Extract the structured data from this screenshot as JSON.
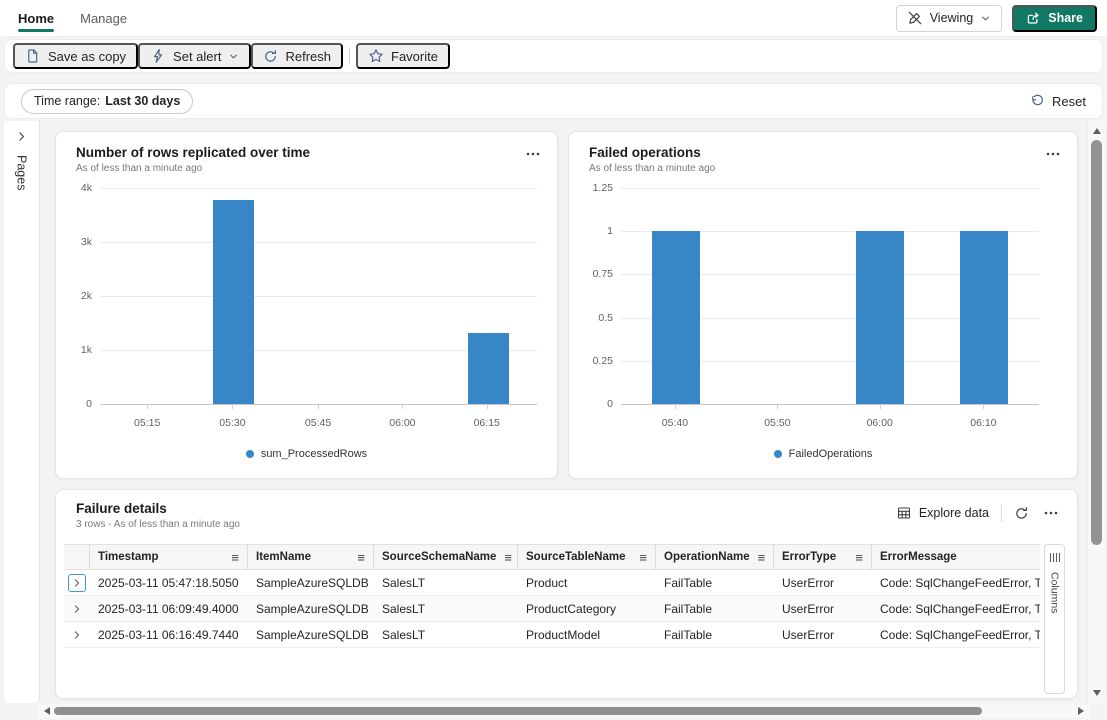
{
  "topbar": {
    "tabs": [
      {
        "label": "Home",
        "active": true
      },
      {
        "label": "Manage",
        "active": false
      }
    ],
    "viewing": {
      "label": "Viewing"
    },
    "share": {
      "label": "Share"
    }
  },
  "toolbar": {
    "save_as_copy_label": "Save as copy",
    "set_alert_label": "Set alert",
    "refresh_label": "Refresh",
    "favorite_label": "Favorite"
  },
  "filter_bar": {
    "time_range_prefix": "Time range:",
    "time_range_value": "Last 30 days",
    "reset_label": "Reset"
  },
  "sidebar": {
    "pages_label": "Pages"
  },
  "chart_data": [
    {
      "type": "bar",
      "title": "Number of rows replicated over time",
      "subtitle": "As of less than a minute ago",
      "legend": "sum_ProcessedRows",
      "color": "#3787c8",
      "ylim": [
        0,
        4000
      ],
      "grid": true,
      "legend_position": "bottom-center",
      "y_ticks": [
        {
          "label": "4k",
          "value": 4000
        },
        {
          "label": "3k",
          "value": 3000
        },
        {
          "label": "2k",
          "value": 2000
        },
        {
          "label": "1k",
          "value": 1000
        },
        {
          "label": "0",
          "value": 0
        }
      ],
      "x_ticks": [
        {
          "label": "05:15",
          "frac": 0.108
        },
        {
          "label": "05:30",
          "frac": 0.303
        },
        {
          "label": "05:45",
          "frac": 0.499
        },
        {
          "label": "06:00",
          "frac": 0.692
        },
        {
          "label": "06:15",
          "frac": 0.885
        }
      ],
      "bars": [
        {
          "x": "05:30",
          "frac": 0.306,
          "value": 3780
        },
        {
          "x": "06:15",
          "frac": 0.89,
          "value": 1320
        }
      ],
      "bar_width_frac": 0.094
    },
    {
      "type": "bar",
      "title": "Failed operations",
      "subtitle": "As of less than a minute ago",
      "legend": "FailedOperations",
      "color": "#3787c8",
      "ylim": [
        0,
        1.25
      ],
      "grid": true,
      "legend_position": "bottom-center",
      "y_ticks": [
        {
          "label": "1.25",
          "value": 1.25
        },
        {
          "label": "1",
          "value": 1
        },
        {
          "label": "0.75",
          "value": 0.75
        },
        {
          "label": "0.5",
          "value": 0.5
        },
        {
          "label": "0.25",
          "value": 0.25
        },
        {
          "label": "0",
          "value": 0
        }
      ],
      "x_ticks": [
        {
          "label": "05:40",
          "frac": 0.129
        },
        {
          "label": "05:50",
          "frac": 0.374
        },
        {
          "label": "06:00",
          "frac": 0.619
        },
        {
          "label": "06:10",
          "frac": 0.867
        }
      ],
      "bars": [
        {
          "x": "05:40",
          "frac": 0.131,
          "value": 1
        },
        {
          "x": "06:00",
          "frac": 0.62,
          "value": 1
        },
        {
          "x": "06:10",
          "frac": 0.868,
          "value": 1
        }
      ],
      "bar_width_frac": 0.114
    }
  ],
  "table": {
    "title": "Failure details",
    "subtitle": "3 rows - As of less than a minute ago",
    "explore_data_label": "Explore data",
    "columns": [
      "Timestamp",
      "ItemName",
      "SourceSchemaName",
      "SourceTableName",
      "OperationName",
      "ErrorType",
      "ErrorMessage"
    ],
    "rows": [
      [
        "2025-03-11 05:47:18.5050",
        "SampleAzureSQLDB",
        "SalesLT",
        "Product",
        "FailTable",
        "UserError",
        "Code: SqlChangeFeedError, Type:"
      ],
      [
        "2025-03-11 06:09:49.4000",
        "SampleAzureSQLDB",
        "SalesLT",
        "ProductCategory",
        "FailTable",
        "UserError",
        "Code: SqlChangeFeedError, Type:"
      ],
      [
        "2025-03-11 06:16:49.7440",
        "SampleAzureSQLDB",
        "SalesLT",
        "ProductModel",
        "FailTable",
        "UserError",
        "Code: SqlChangeFeedError, Type:"
      ]
    ],
    "columns_panel_label": "Columns"
  },
  "icons": {
    "column_menu_glyph": "≡"
  },
  "colors": {
    "accent": "#117865",
    "bar": "#3787c8",
    "page_bg": "#f3f3f3"
  }
}
